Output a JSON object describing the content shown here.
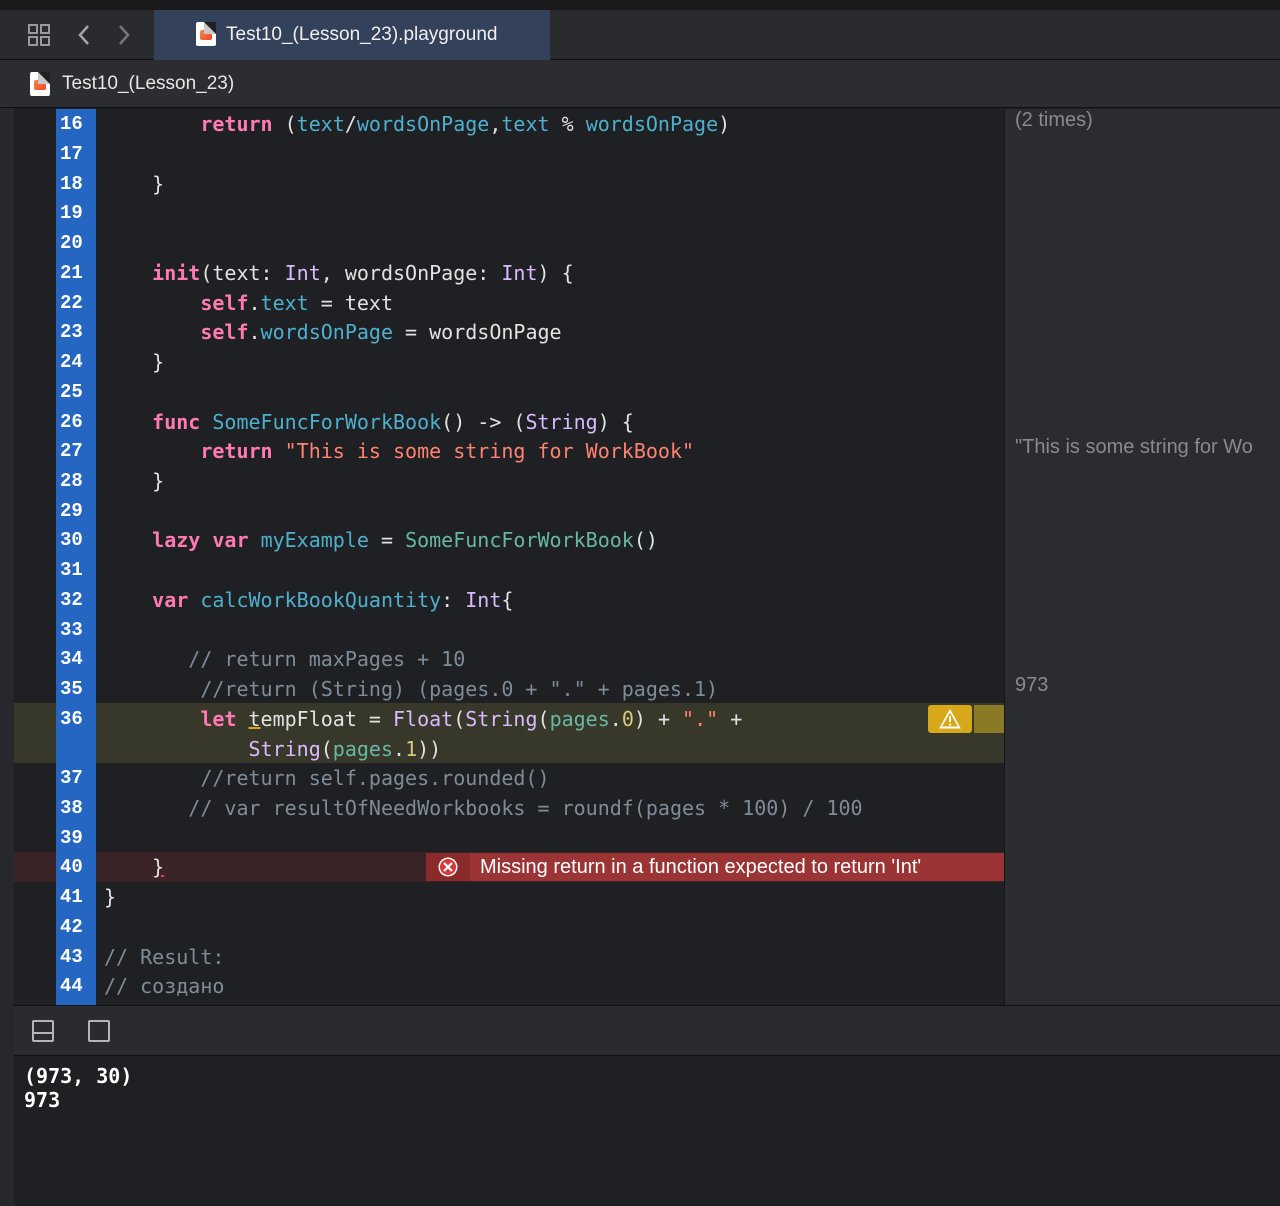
{
  "tabbar": {
    "active_tab": "Test10_(Lesson_23).playground",
    "grid_icon": "related-items-grid-icon",
    "back_icon": "chevron-left-icon",
    "forward_icon": "chevron-right-icon"
  },
  "jumpbar": {
    "file": "Test10_(Lesson_23)"
  },
  "editor": {
    "lines": [
      {
        "n": "16"
      },
      {
        "n": "17"
      },
      {
        "n": "18"
      },
      {
        "n": "19"
      },
      {
        "n": "20"
      },
      {
        "n": "21"
      },
      {
        "n": "22"
      },
      {
        "n": "23"
      },
      {
        "n": "24"
      },
      {
        "n": "25"
      },
      {
        "n": "26"
      },
      {
        "n": "27"
      },
      {
        "n": "28"
      },
      {
        "n": "29"
      },
      {
        "n": "30"
      },
      {
        "n": "31"
      },
      {
        "n": "32"
      },
      {
        "n": "33"
      },
      {
        "n": "34"
      },
      {
        "n": "35"
      },
      {
        "n": "36"
      },
      {
        "n": "37"
      },
      {
        "n": "38"
      },
      {
        "n": "39"
      },
      {
        "n": "40"
      },
      {
        "n": "41"
      },
      {
        "n": "42"
      },
      {
        "n": "43"
      },
      {
        "n": "44"
      }
    ],
    "code": {
      "l16": "(2 times)",
      "error_message": "Missing return in a function expected to return 'Int'"
    }
  },
  "results": {
    "r16": "(2 times)",
    "r27": "\"This is some string for Wo",
    "r35": "973"
  },
  "console": {
    "line1": "(973, 30)",
    "line2": "973"
  },
  "colors": {
    "keyword": "#ff7ab2",
    "type": "#dabaff",
    "function": "#67b7a4",
    "string": "#ff8170",
    "comment": "#7f8c98",
    "gutter": "#2566c2",
    "error": "#9b3434",
    "warning": "#d7a81a"
  }
}
